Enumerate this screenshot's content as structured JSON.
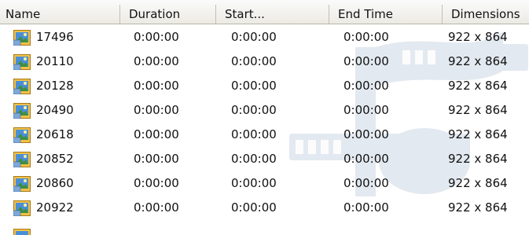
{
  "columns": [
    {
      "label": "Name"
    },
    {
      "label": "Duration"
    },
    {
      "label": "Start..."
    },
    {
      "label": "End Time"
    },
    {
      "label": "Dimensions"
    }
  ],
  "sort": {
    "column": "Start...",
    "direction": "ascending",
    "icon": "sort-triangle-icon"
  },
  "row_icon": "image-file-icon",
  "watermark_icon": "film-music-note-watermark",
  "rows": [
    {
      "name": "17496",
      "duration": "0:00:00",
      "start": "0:00:00",
      "end": "0:00:00",
      "dimensions": "922 x 864"
    },
    {
      "name": "20110",
      "duration": "0:00:00",
      "start": "0:00:00",
      "end": "0:00:00",
      "dimensions": "922 x 864"
    },
    {
      "name": "20128",
      "duration": "0:00:00",
      "start": "0:00:00",
      "end": "0:00:00",
      "dimensions": "922 x 864"
    },
    {
      "name": "20490",
      "duration": "0:00:00",
      "start": "0:00:00",
      "end": "0:00:00",
      "dimensions": "922 x 864"
    },
    {
      "name": "20618",
      "duration": "0:00:00",
      "start": "0:00:00",
      "end": "0:00:00",
      "dimensions": "922 x 864"
    },
    {
      "name": "20852",
      "duration": "0:00:00",
      "start": "0:00:00",
      "end": "0:00:00",
      "dimensions": "922 x 864"
    },
    {
      "name": "20860",
      "duration": "0:00:00",
      "start": "0:00:00",
      "end": "0:00:00",
      "dimensions": "922 x 864"
    },
    {
      "name": "20922",
      "duration": "0:00:00",
      "start": "0:00:00",
      "end": "0:00:00",
      "dimensions": "922 x 864"
    }
  ],
  "colors": {
    "watermark": "#dfe6ee",
    "header_bg": "#eceae3",
    "icon_frame": "#e2a52a",
    "icon_sky": "#4a8fd6"
  }
}
